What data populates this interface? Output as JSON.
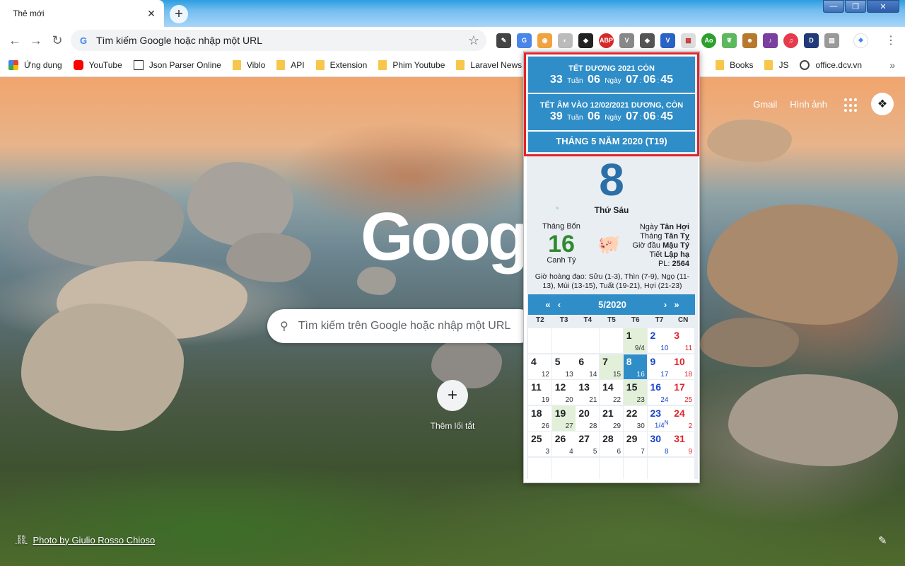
{
  "browser": {
    "tab_title": "Thẻ mới",
    "omnibox_placeholder": "Tìm kiếm Google hoặc nhập một URL"
  },
  "bookmarks": [
    {
      "label": "Ứng dụng",
      "icon": "apps-icon"
    },
    {
      "label": "YouTube",
      "icon": "youtube-icon"
    },
    {
      "label": "Json Parser Online",
      "icon": "json-icon"
    },
    {
      "label": "Viblo",
      "icon": "folder-icon"
    },
    {
      "label": "API",
      "icon": "folder-icon"
    },
    {
      "label": "Extension",
      "icon": "folder-icon"
    },
    {
      "label": "Phim Youtube",
      "icon": "folder-icon"
    },
    {
      "label": "Laravel News",
      "icon": "folder-icon"
    },
    {
      "label": "Books",
      "icon": "folder-icon"
    },
    {
      "label": "JS",
      "icon": "folder-icon"
    },
    {
      "label": "office.dcv.vn",
      "icon": "globe-icon"
    }
  ],
  "newtab": {
    "gmail": "Gmail",
    "images": "Hình ảnh",
    "logo": "Google",
    "search_placeholder": "Tìm kiếm trên Google hoặc nhập một URL",
    "add_shortcut": "Thêm lối tắt",
    "photo_credit": "Photo by Giulio Rosso Chioso"
  },
  "calendar": {
    "solar_new_year": {
      "title": "TẾT DƯƠNG 2021 CÒN",
      "weeks": "33",
      "weeks_label": "Tuần",
      "days": "06",
      "days_label": "Ngày",
      "h": "07",
      "m": "06",
      "s": "45"
    },
    "lunar_new_year": {
      "title": "TẾT ÂM VÀO 12/02/2021 DƯƠNG, CÒN",
      "weeks": "39",
      "weeks_label": "Tuần",
      "days": "06",
      "days_label": "Ngày",
      "h": "07",
      "m": "06",
      "s": "45"
    },
    "month_banner": "THÁNG 5 NĂM 2020 (T19)",
    "day": "8",
    "weekday": "Thứ Sáu",
    "lunar_month": "Tháng Bốn",
    "lunar_day": "16",
    "lunar_year": "Canh Tý",
    "can_chi": {
      "day_label": "Ngày",
      "day_val": "Tân Hợi",
      "month_label": "Tháng",
      "month_val": "Tân Tỵ",
      "hour_label": "Giờ đầu",
      "hour_val": "Mậu Tý",
      "term_label": "Tiết",
      "term_val": "Lập hạ",
      "pl_label": "PL:",
      "pl_val": "2564"
    },
    "gio_hoang_dao": "Giờ hoàng đạo: Sửu (1-3), Thìn (7-9), Ngọ (11-13), Mùi (13-15), Tuất (19-21), Hợi (21-23)",
    "nav": {
      "prev_year": "«",
      "prev_month": "‹",
      "next_month": "›",
      "next_year": "»"
    },
    "month_title": "5/2020",
    "dow": [
      "T2",
      "T3",
      "T4",
      "T5",
      "T6",
      "T7",
      "CN"
    ],
    "weeks": [
      [
        null,
        null,
        null,
        null,
        {
          "s": "1",
          "l": "9/4",
          "g": true
        },
        {
          "s": "2",
          "l": "10",
          "c": "blue"
        },
        {
          "s": "3",
          "l": "11",
          "c": "red"
        }
      ],
      [
        {
          "s": "4",
          "l": "12"
        },
        {
          "s": "5",
          "l": "13"
        },
        {
          "s": "6",
          "l": "14"
        },
        {
          "s": "7",
          "l": "15",
          "g": true
        },
        {
          "s": "8",
          "l": "16",
          "t": true
        },
        {
          "s": "9",
          "l": "17",
          "c": "blue"
        },
        {
          "s": "10",
          "l": "18",
          "c": "red"
        }
      ],
      [
        {
          "s": "11",
          "l": "19"
        },
        {
          "s": "12",
          "l": "20"
        },
        {
          "s": "13",
          "l": "21"
        },
        {
          "s": "14",
          "l": "22"
        },
        {
          "s": "15",
          "l": "23",
          "g": true
        },
        {
          "s": "16",
          "l": "24",
          "c": "blue"
        },
        {
          "s": "17",
          "l": "25",
          "c": "red"
        }
      ],
      [
        {
          "s": "18",
          "l": "26"
        },
        {
          "s": "19",
          "l": "27",
          "g": true
        },
        {
          "s": "20",
          "l": "28"
        },
        {
          "s": "21",
          "l": "29"
        },
        {
          "s": "22",
          "l": "30"
        },
        {
          "s": "23",
          "l": "1/4",
          "c": "blue",
          "n": true
        },
        {
          "s": "24",
          "l": "2",
          "c": "red"
        }
      ],
      [
        {
          "s": "25",
          "l": "3"
        },
        {
          "s": "26",
          "l": "4"
        },
        {
          "s": "27",
          "l": "5"
        },
        {
          "s": "28",
          "l": "6"
        },
        {
          "s": "29",
          "l": "7"
        },
        {
          "s": "30",
          "l": "8",
          "c": "blue"
        },
        {
          "s": "31",
          "l": "9",
          "c": "red"
        }
      ],
      [
        null,
        null,
        null,
        null,
        null,
        null,
        null
      ]
    ]
  },
  "colors": {
    "calendar_blue": "#2f8dc7",
    "highlight_red": "#e0242b",
    "lunar_green": "#2f8a2f"
  }
}
